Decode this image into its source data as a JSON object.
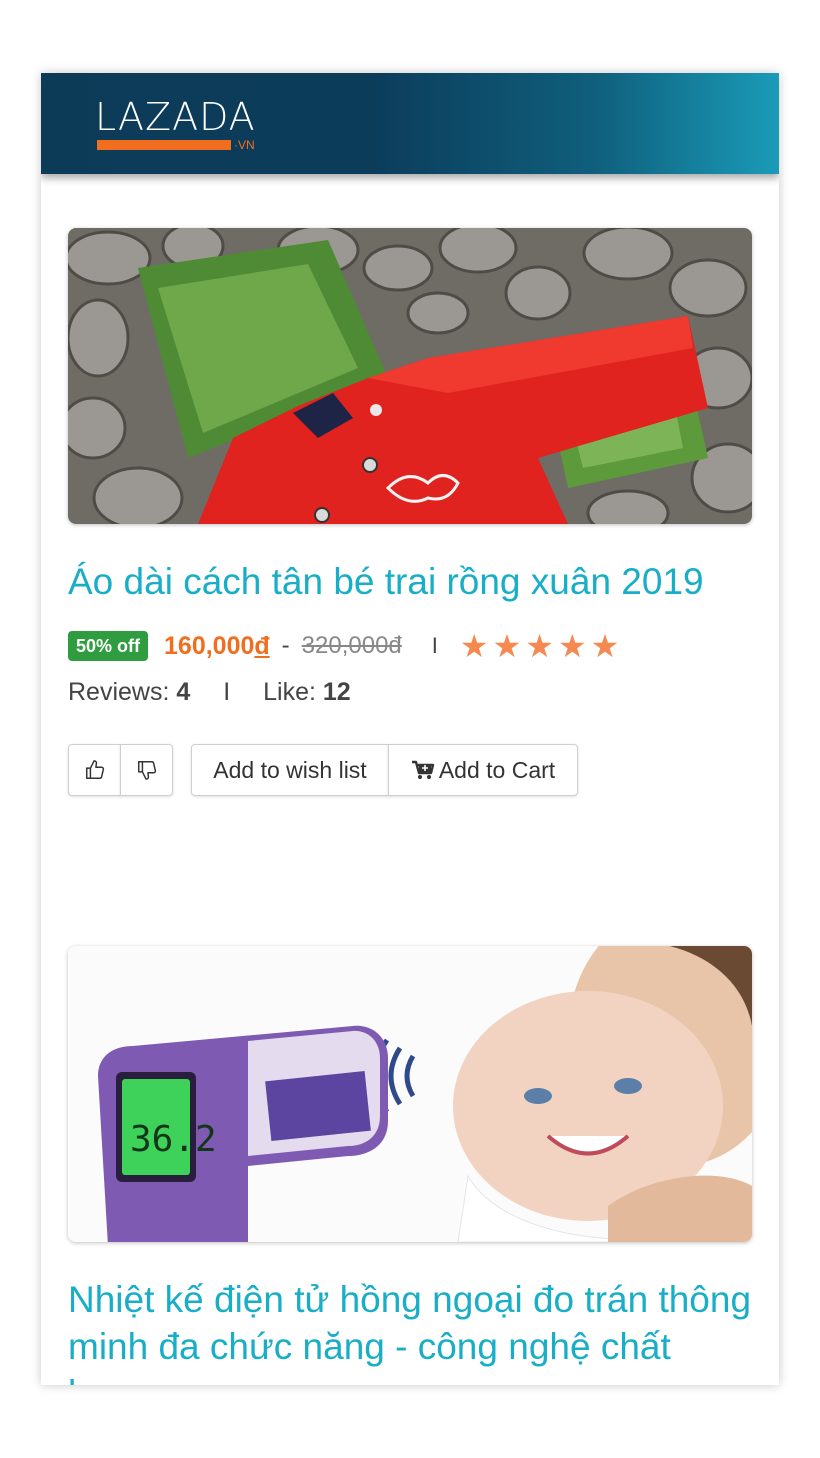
{
  "header": {
    "logo_text": "LAZADA",
    "logo_suffix": "·VN",
    "colors": {
      "bar_start": "#0c3b58",
      "bar_end": "#1a9bb8",
      "logo_accent": "#f26e1f"
    }
  },
  "products": [
    {
      "title": "Áo dài cách tân bé trai rồng xuân 2019",
      "image": "red-boys-ao-dai-on-grass-and-stones",
      "badge": "50% off",
      "price": "160,000",
      "currency": "đ",
      "separator": "-",
      "old_price": "320,000đ",
      "divider": "I",
      "rating": 5,
      "stars": "★★★★★",
      "reviews_label": "Reviews:",
      "reviews_count": "4",
      "likes_label": "Like:",
      "likes_count": "12",
      "like_icon": "thumbs-up-icon",
      "dislike_icon": "thumbs-down-icon",
      "wishlist_label": "Add to wish list",
      "cart_label": "Add to Cart",
      "cart_icon": "cart-icon"
    },
    {
      "title": "Nhiệt kế điện tử hồng ngoại đo trán thông minh đa chức năng - công nghệ chất lượng cao",
      "image": "infrared-thermometer-with-mother-and-baby",
      "thermometer_reading": "36.2"
    }
  ],
  "colors": {
    "title": "#19aec7",
    "price": "#f26e1f",
    "badge": "#2e9c3f",
    "stars": "#f5894f"
  }
}
